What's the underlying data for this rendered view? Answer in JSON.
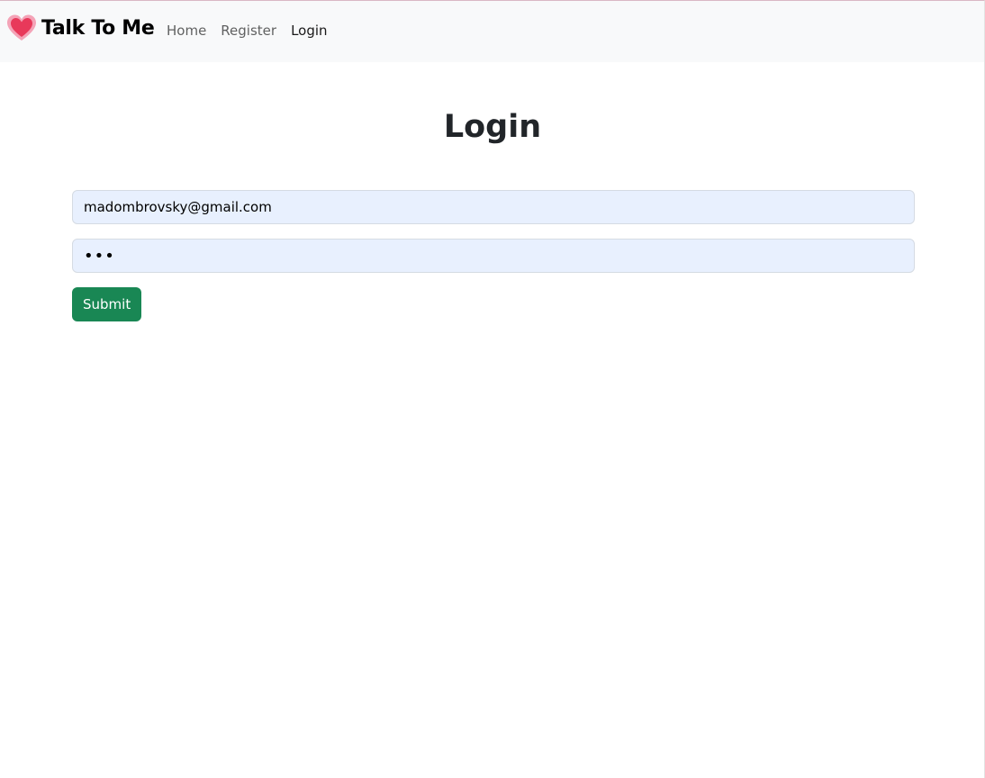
{
  "navbar": {
    "brand_icon": "heart-icon",
    "brand": "Talk To Me",
    "links": [
      {
        "label": "Home"
      },
      {
        "label": "Register"
      },
      {
        "label": "Login"
      }
    ],
    "active_link": "Login"
  },
  "main": {
    "title": "Login",
    "email": {
      "value": "madombrovsky@gmail.com"
    },
    "password": {
      "value": "•••"
    },
    "submit_label": "Submit"
  },
  "colors": {
    "navbar_bg": "#f8f9fa",
    "input_bg": "#e8f0fe",
    "submit_bg": "#198754",
    "heart": "#e8395a"
  }
}
